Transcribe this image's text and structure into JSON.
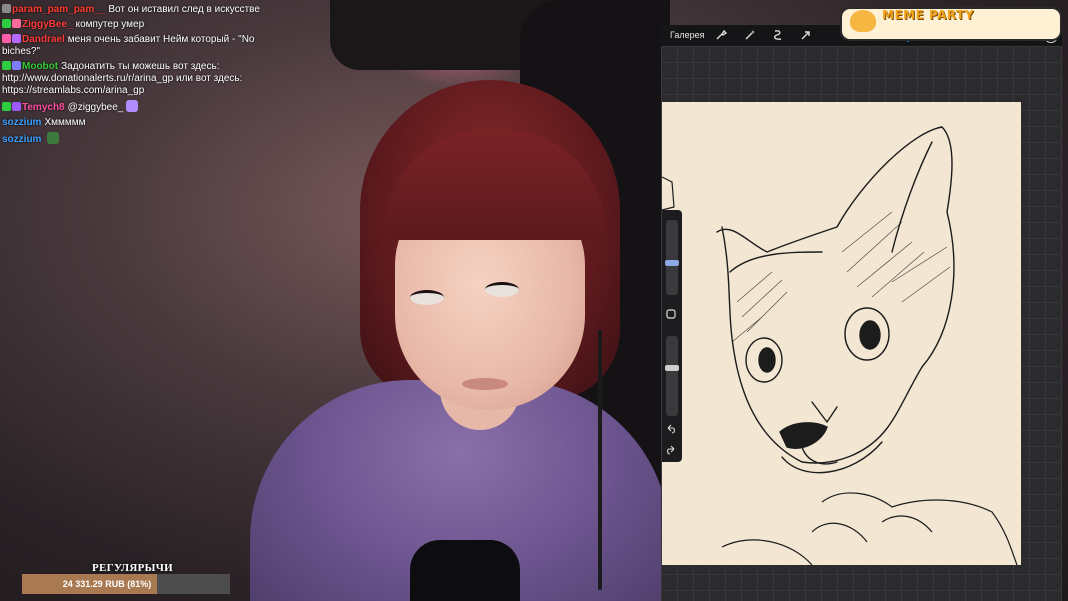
{
  "chat": [
    {
      "user": "param_pam_pam__",
      "color": "#ff3b30",
      "text": "Вот он иставил след в искусстве",
      "badges": [
        "#8a8a8a"
      ]
    },
    {
      "user": "ZiggyBee_",
      "color": "#ff3b3b",
      "text": "компутер умер",
      "badges": [
        "#2ecc40",
        "#ff6b9a"
      ]
    },
    {
      "user": "Dandrael",
      "color": "#ff3b3b",
      "text": "меня очень забавит Нейм который - \"No biches?\"",
      "badges": [
        "#ff5ea8",
        "#b36bff"
      ]
    },
    {
      "user": "Moobot",
      "color": "#33cc33",
      "text": "Задонатить ты можешь вот здесь: http://www.donationalerts.ru/r/arina_gp или вот здесь: https://streamlabs.com/arina_gp",
      "badges": [
        "#2ecc40",
        "#7d7dff"
      ]
    },
    {
      "user": "Temych8",
      "color": "#ff4fa3",
      "text": "@ziggybee_",
      "badges": [
        "#2ecc40",
        "#9b59ff"
      ],
      "emote": "#b18cff"
    },
    {
      "user": "sozzium",
      "color": "#3aa0ff",
      "text": "Хммммм",
      "badges": []
    },
    {
      "user": "sozzium",
      "color": "#3aa0ff",
      "text": "",
      "badges": [],
      "emote": "#3d7a3d"
    }
  ],
  "goal": {
    "title": "РЕГУЛЯРЫЧИ",
    "amount": "24 331.29 RUB (81%)",
    "progress": 0.81
  },
  "procreate": {
    "gallery_label": "Галерея",
    "toolbar_icons": [
      "wrench-icon",
      "magic-wand-icon",
      "selection-icon",
      "transform-arrow-icon"
    ],
    "tool_icons": [
      "brush-icon",
      "smudge-icon",
      "eraser-icon",
      "layers-icon",
      "color-swatch-icon"
    ],
    "brush_color": "#1f6fe0"
  },
  "logo": {
    "text": "MEME PARTY"
  }
}
